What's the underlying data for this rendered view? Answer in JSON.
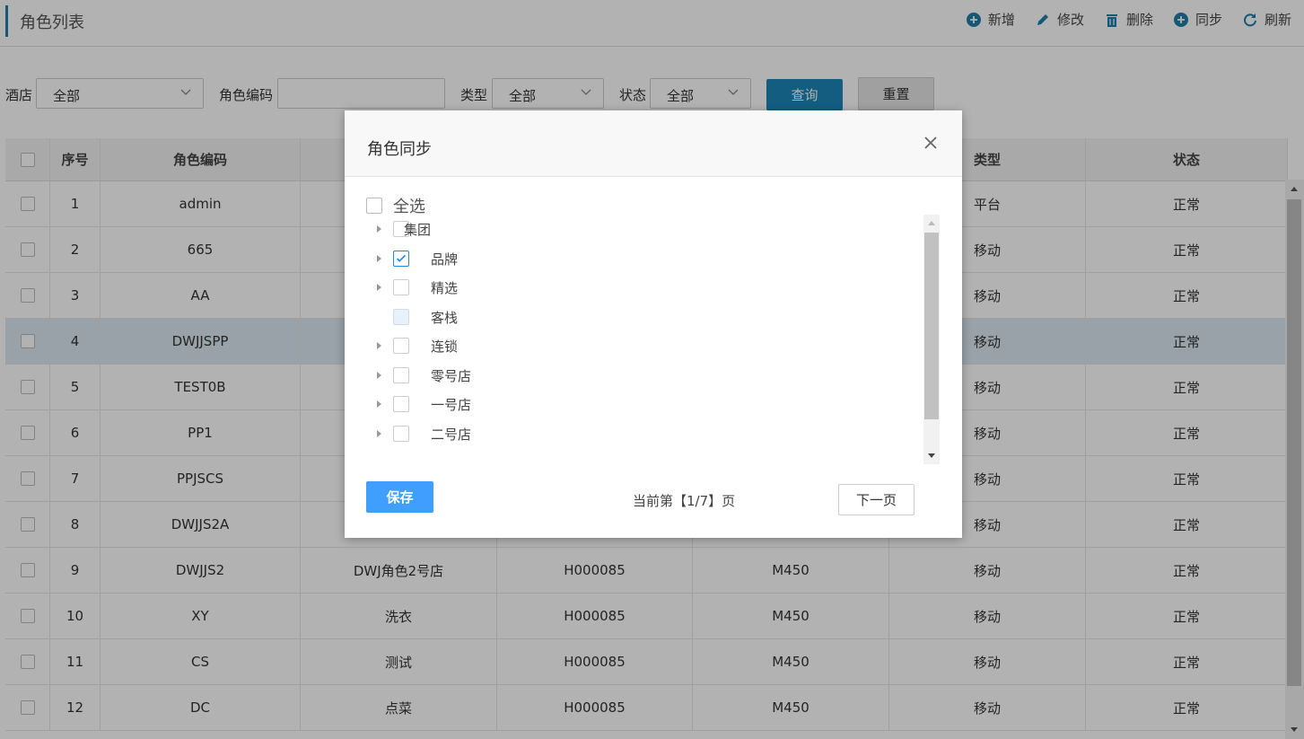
{
  "header": {
    "title": "角色列表",
    "toolbar": [
      {
        "label": "新增",
        "icon": "plus-circle-icon"
      },
      {
        "label": "修改",
        "icon": "pencil-icon"
      },
      {
        "label": "删除",
        "icon": "trash-icon"
      },
      {
        "label": "同步",
        "icon": "plus-circle-icon"
      },
      {
        "label": "刷新",
        "icon": "refresh-icon"
      }
    ]
  },
  "filters": {
    "hotel_label": "酒店",
    "hotel_value": "全部",
    "code_label": "角色编码",
    "code_value": "",
    "type_label": "类型",
    "type_value": "全部",
    "status_label": "状态",
    "status_value": "全部",
    "query_label": "查询",
    "reset_label": "重置"
  },
  "table": {
    "headers": [
      "序号",
      "角色编码",
      "类型",
      "状态"
    ],
    "rows": [
      {
        "no": "1",
        "code": "admin",
        "name": "",
        "hotel": "",
        "org": "",
        "type": "平台",
        "status": "正常"
      },
      {
        "no": "2",
        "code": "665",
        "name": "",
        "hotel": "",
        "org": "",
        "type": "移动",
        "status": "正常"
      },
      {
        "no": "3",
        "code": "AA",
        "name": "",
        "hotel": "",
        "org": "",
        "type": "移动",
        "status": "正常"
      },
      {
        "no": "4",
        "code": "DWJJSPP",
        "name": "",
        "hotel": "",
        "org": "",
        "type": "移动",
        "status": "正常"
      },
      {
        "no": "5",
        "code": "TEST0B",
        "name": "",
        "hotel": "",
        "org": "",
        "type": "移动",
        "status": "正常"
      },
      {
        "no": "6",
        "code": "PP1",
        "name": "",
        "hotel": "",
        "org": "",
        "type": "移动",
        "status": "正常"
      },
      {
        "no": "7",
        "code": "PPJSCS",
        "name": "",
        "hotel": "",
        "org": "",
        "type": "移动",
        "status": "正常"
      },
      {
        "no": "8",
        "code": "DWJJS2A",
        "name": "",
        "hotel": "",
        "org": "",
        "type": "移动",
        "status": "正常"
      },
      {
        "no": "9",
        "code": "DWJJS2",
        "name": "DWJ角色2号店",
        "hotel": "H000085",
        "org": "M450",
        "type": "移动",
        "status": "正常"
      },
      {
        "no": "10",
        "code": "XY",
        "name": "洗衣",
        "hotel": "H000085",
        "org": "M450",
        "type": "移动",
        "status": "正常"
      },
      {
        "no": "11",
        "code": "CS",
        "name": "测试",
        "hotel": "H000085",
        "org": "M450",
        "type": "移动",
        "status": "正常"
      },
      {
        "no": "12",
        "code": "DC",
        "name": "点菜",
        "hotel": "H000085",
        "org": "M450",
        "type": "移动",
        "status": "正常"
      }
    ],
    "highlighted_row": 4
  },
  "modal": {
    "title": "角色同步",
    "select_all_label": "全选",
    "tree": [
      {
        "label": "集团",
        "checked": false,
        "expandable": true,
        "indent": false
      },
      {
        "label": "品牌",
        "checked": true,
        "expandable": true,
        "indent": true
      },
      {
        "label": "精选",
        "checked": false,
        "expandable": true,
        "indent": true
      },
      {
        "label": "客栈",
        "checked": false,
        "expandable": false,
        "indent": true,
        "disabled": true
      },
      {
        "label": "连锁",
        "checked": false,
        "expandable": true,
        "indent": true
      },
      {
        "label": "零号店",
        "checked": false,
        "expandable": true,
        "indent": true
      },
      {
        "label": "一号店",
        "checked": false,
        "expandable": true,
        "indent": true
      },
      {
        "label": "二号店",
        "checked": false,
        "expandable": true,
        "indent": true
      }
    ],
    "save_label": "保存",
    "page_info": "当前第【1/7】页",
    "next_label": "下一页"
  },
  "colors": {
    "accent": "#1e7ea8",
    "query_button": "#1a86b8",
    "save_button": "#409eff",
    "checkbox_check": "#1e88e5",
    "highlight_row": "#dbe9f1"
  }
}
